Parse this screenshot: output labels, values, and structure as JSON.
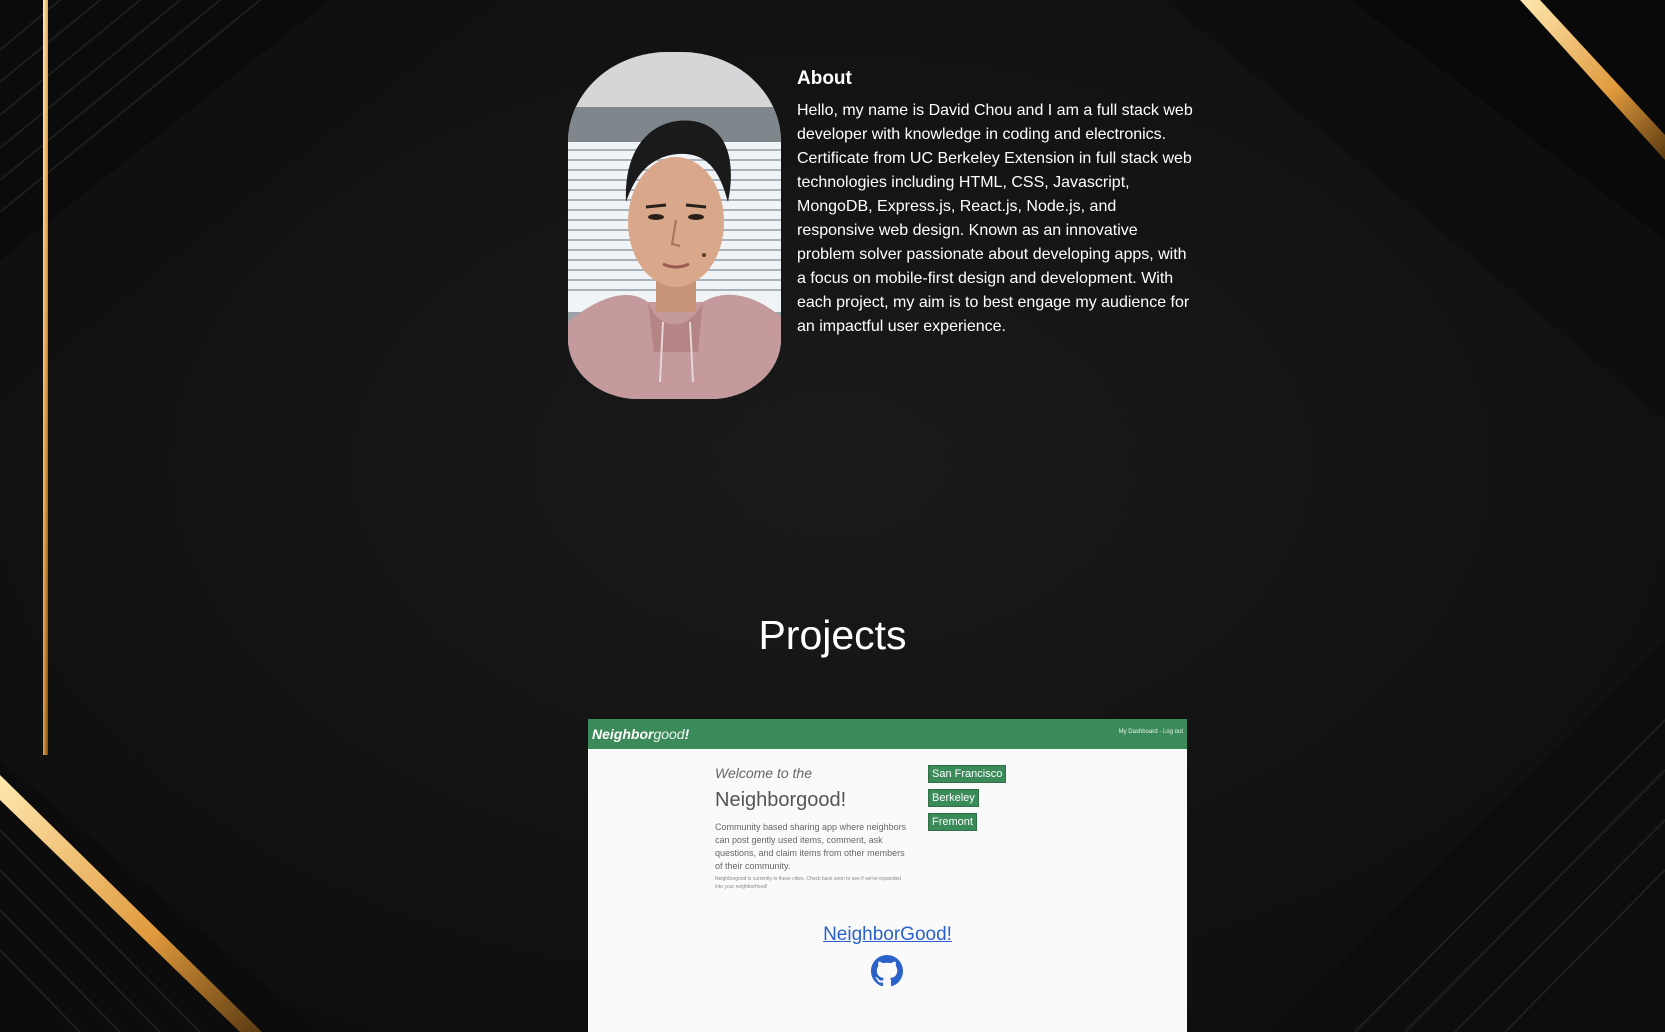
{
  "about": {
    "title": "About",
    "body": "Hello, my name is David Chou and I am a full stack web developer with knowledge in coding and electronics. Certificate from UC Berkeley Extension in full stack web technologies including HTML, CSS, Javascript, MongoDB, Express.js, React.js, Node.js, and responsive web design. Known as an innovative problem solver passionate about developing apps, with a focus on mobile-first design and development. With each project, my aim is to best engage my audience for an impactful user experience."
  },
  "projects": {
    "title": "Projects",
    "items": [
      {
        "link_label": "NeighborGood!",
        "screenshot": {
          "logo_bold": "Neighbor",
          "logo_light": "good",
          "logo_bang": "!",
          "nav_links": "My Dashboard · Log out",
          "welcome": "Welcome to the",
          "heading": "Neighborgood!",
          "description": "Community based sharing app where neighbors can post gently used items, comment, ask questions, and claim items from other members of their community.",
          "note": "Neighborgood is currently in these cities. Check back soon to see if we've expanded into your neighborhood!",
          "cities": [
            "San Francisco",
            "Berkeley",
            "Fremont"
          ]
        },
        "icon": "github-icon"
      }
    ]
  },
  "colors": {
    "background": "#161616",
    "gold_accent": "#e5a34a",
    "project_green": "#3b8a5a",
    "link_blue": "#2a62c9"
  }
}
